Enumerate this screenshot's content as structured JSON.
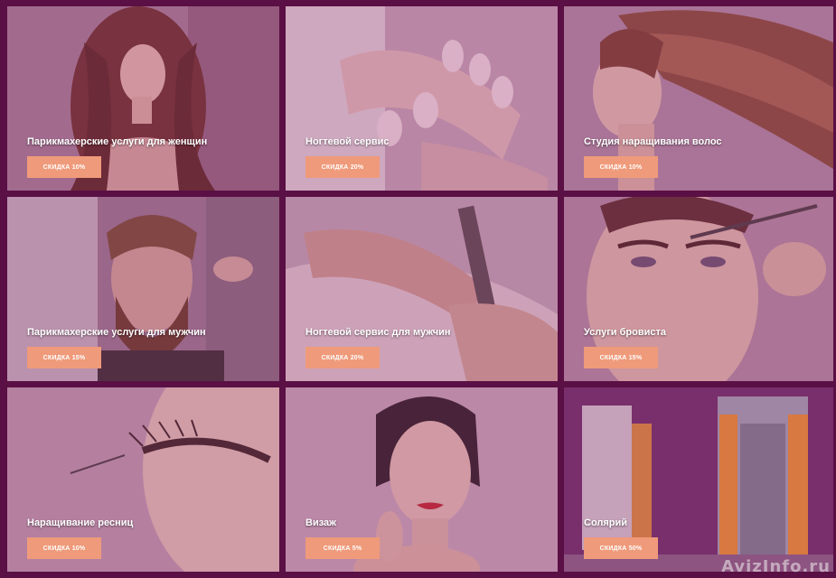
{
  "tiles": [
    {
      "title": "Парикмахерские услуги для женщин",
      "button": "СКИДКА 10%",
      "image": "woman-curly-hair"
    },
    {
      "title": "Ногтевой сервис",
      "button": "СКИДКА 20%",
      "image": "manicure-hands"
    },
    {
      "title": "Студия наращивания волос",
      "button": "СКИДКА 10%",
      "image": "woman-long-hair-profile"
    },
    {
      "title": "Парикмахерские услуги для мужчин",
      "button": "СКИДКА 15%",
      "image": "bearded-man-haircut"
    },
    {
      "title": "Ногтевой сервис для мужчин",
      "button": "СКИДКА 20%",
      "image": "male-manicure-nail-file"
    },
    {
      "title": "Услуги бровиста",
      "button": "СКИДКА 15%",
      "image": "eyebrow-shaping"
    },
    {
      "title": "Наращивание ресниц",
      "button": "СКИДКА 10%",
      "image": "eyelash-extension"
    },
    {
      "title": "Визаж",
      "button": "СКИДКА 5%",
      "image": "makeup-woman-red-lips"
    },
    {
      "title": "Солярий",
      "button": "СКИДКА 50%",
      "image": "tanning-booth"
    }
  ],
  "watermark": "AvizInfo.ru",
  "colors": {
    "background": "#5a0f45",
    "button": "#ef9a7a",
    "overlay": "#963c78"
  }
}
